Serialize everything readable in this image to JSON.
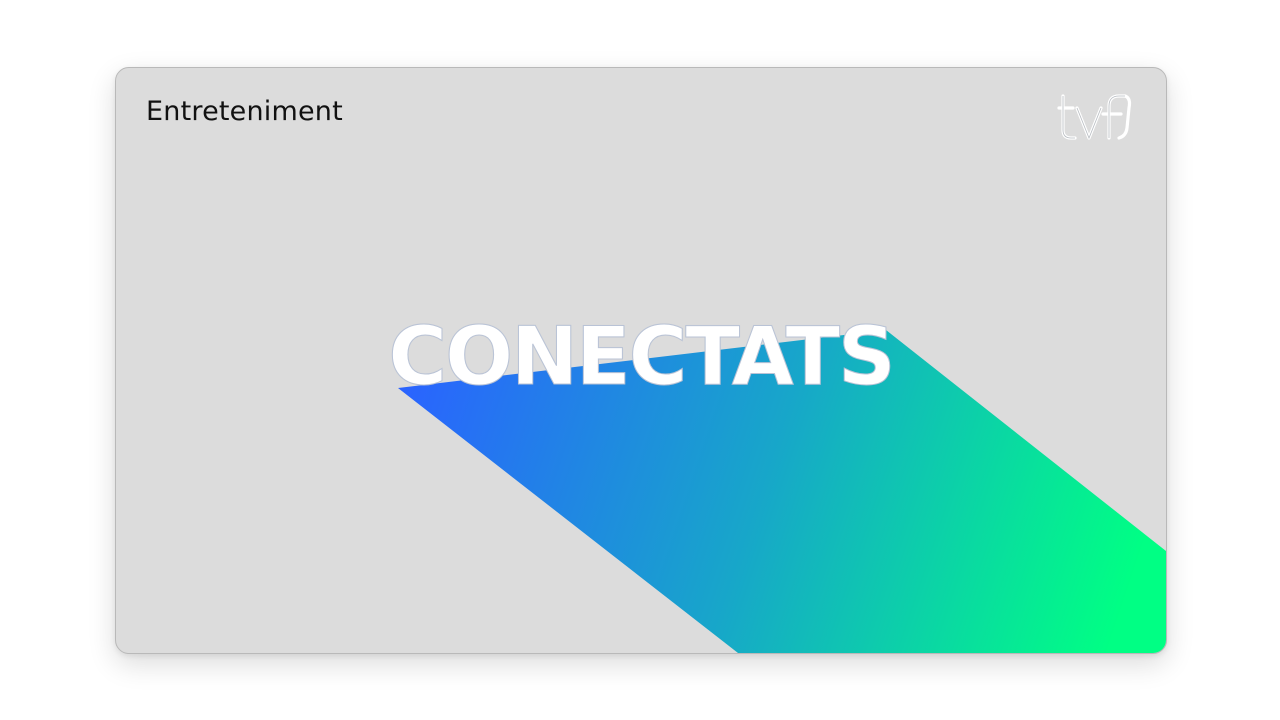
{
  "card": {
    "category": "Entreteniment",
    "title": "CONECTATS",
    "logo": {
      "text": "tvf",
      "icon": "tvf-logo-icon"
    }
  },
  "colors": {
    "card_background": "#dcdcdc",
    "page_background": "#ffffff",
    "title_text": "#ffffff",
    "gradient_start": "#2a63ff",
    "gradient_mid": "#17a7c9",
    "gradient_end": "#00ff84"
  }
}
